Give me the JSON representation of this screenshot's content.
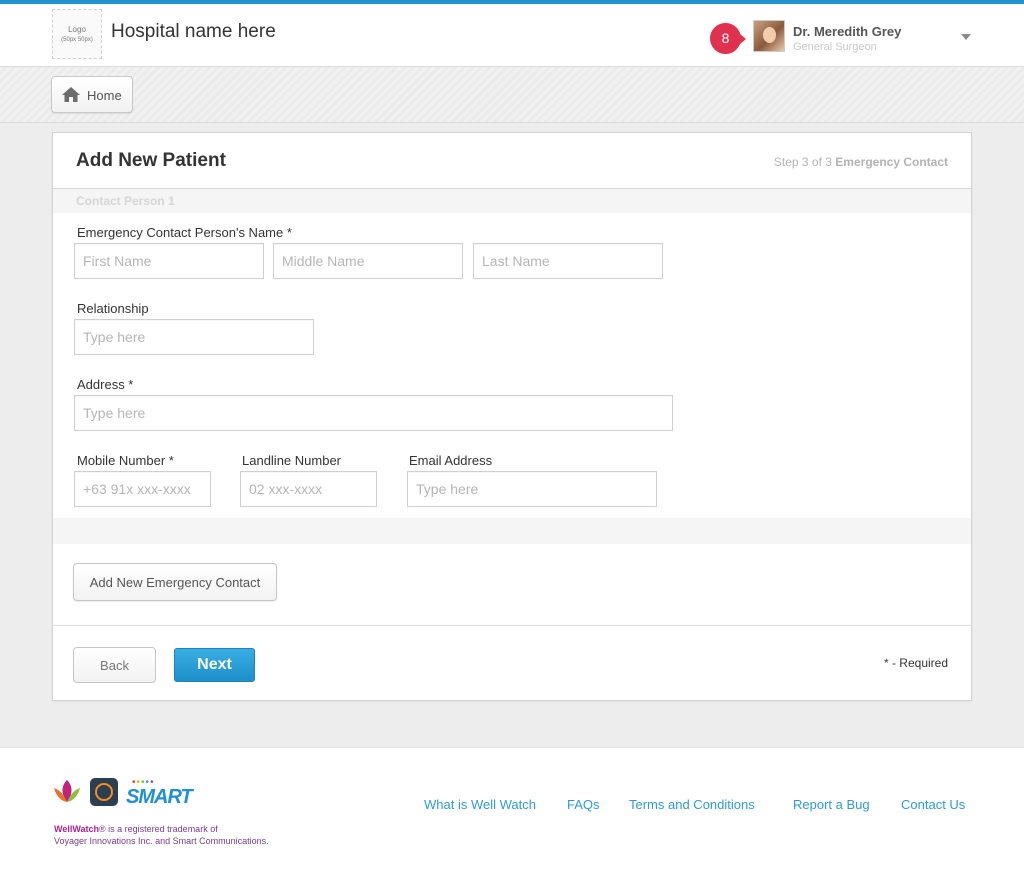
{
  "header": {
    "logo_line1": "Logo",
    "logo_line2": "(50px 50px)",
    "hospital_name": "Hospital name here",
    "notification_count": "8",
    "user_name": "Dr. Meredith Grey",
    "user_role": "General Surgeon"
  },
  "breadcrumb": {
    "home_label": "Home"
  },
  "form": {
    "title": "Add New Patient",
    "step_prefix": "Step 3 of 3",
    "step_name": "Emergency Contact",
    "section_title": "Contact Person 1",
    "name_label": "Emergency Contact Person's Name *",
    "first_name_placeholder": "First Name",
    "middle_name_placeholder": "Middle Name",
    "last_name_placeholder": "Last Name",
    "relationship_label": "Relationship",
    "relationship_placeholder": "Type here",
    "address_label": "Address *",
    "address_placeholder": "Type here",
    "mobile_label": "Mobile Number *",
    "mobile_placeholder": "+63 91x xxx-xxxx",
    "landline_label": "Landline Number",
    "landline_placeholder": "02 xxx-xxxx",
    "email_label": "Email Address",
    "email_placeholder": "Type here",
    "add_contact_label": "Add New Emergency Contact",
    "back_label": "Back",
    "next_label": "Next",
    "required_note": "* - Required"
  },
  "footer": {
    "smart_logo": "SMART",
    "trademark_brand": "WellWatch",
    "trademark_line1": "® is a registered trademark of",
    "trademark_line2": "Voyager Innovations Inc. and Smart Communications.",
    "links": [
      "What is Well Watch",
      "FAQs",
      "Terms and Conditions",
      "Report a Bug",
      "Contact Us"
    ]
  },
  "colors": {
    "accent": "#1f93d4",
    "notification": "#e0314f",
    "next_button": "#2a9fd8",
    "link": "#2f9ad8"
  }
}
